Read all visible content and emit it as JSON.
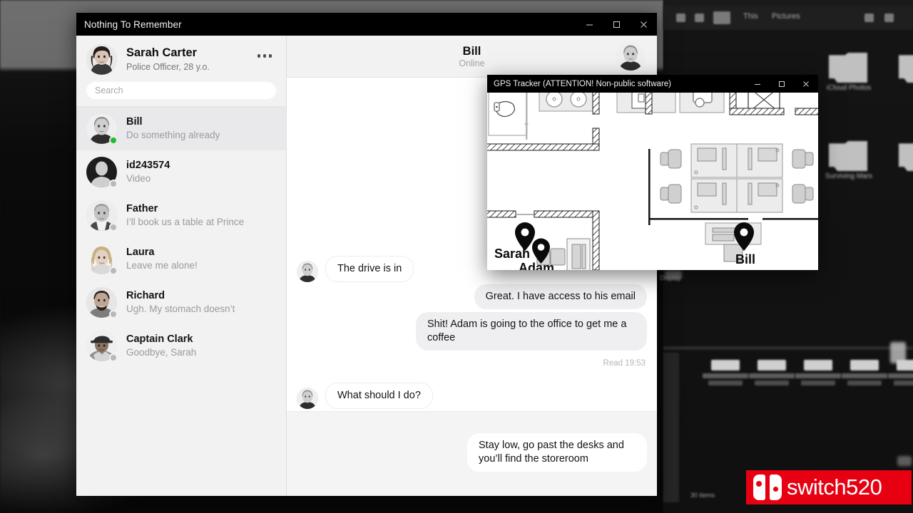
{
  "desktop": {
    "explorer": {
      "breadcrumb_this_pc": "This",
      "breadcrumb_pictures": "Pictures"
    },
    "folders": [
      {
        "label": "iCloud Photos"
      },
      {
        "label": "Surviving Mars"
      }
    ]
  },
  "messenger": {
    "window_title": "Nothing To Remember",
    "window_controls": {
      "minimize": "minimize-icon",
      "maximize": "maximize-icon",
      "close": "close-icon"
    },
    "profile": {
      "name": "Sarah Carter",
      "subtitle": "Police Officer, 28 y.o.",
      "menu_icon": "more-options-icon"
    },
    "search": {
      "value": "",
      "placeholder": "Search"
    },
    "contacts": [
      {
        "name": "Bill",
        "preview": "Do something already",
        "status": "online",
        "active": true
      },
      {
        "name": "id243574",
        "preview": "Video",
        "status": "offline",
        "active": false
      },
      {
        "name": "Father",
        "preview": "I’ll book us a table at Prince",
        "status": "offline",
        "active": false
      },
      {
        "name": "Laura",
        "preview": "Leave me alone!",
        "status": "offline",
        "active": false
      },
      {
        "name": "Richard",
        "preview": "Ugh. My stomach doesn’t",
        "status": "offline",
        "active": false
      },
      {
        "name": "Captain Clark",
        "preview": "Goodbye, Sarah",
        "status": "offline",
        "active": false
      }
    ],
    "chat": {
      "contact_name": "Bill",
      "contact_status": "Online",
      "messages": [
        {
          "text": "The drive is in",
          "side": "in"
        },
        {
          "text": "Great. I have access to his email",
          "side": "out"
        },
        {
          "text": "Shit! Adam is going to the office to get me a coffee",
          "side": "out"
        },
        {
          "text": "What should I do?",
          "side": "in"
        },
        {
          "text": "Stay low, go past the desks and you’ll find the storeroom",
          "side": "draft"
        }
      ],
      "read_receipt": "Read 19:53"
    }
  },
  "gps": {
    "window_title": "GPS Tracker (ATTENTION! Non-public software)",
    "window_controls": {
      "minimize": "minimize-icon",
      "maximize": "maximize-icon",
      "close": "close-icon"
    },
    "markers": [
      {
        "label": "Sarah"
      },
      {
        "label": "Adam"
      },
      {
        "label": "Bill"
      }
    ]
  },
  "watermark": {
    "text": "switch520",
    "brand_color": "#e60012"
  },
  "colors": {
    "titlebar": "#000000",
    "sidebar_bg": "#f2f2f3",
    "bubble_out": "#efeff1",
    "online_green": "#19bf2b",
    "offline_gray": "#b9b9bd"
  }
}
